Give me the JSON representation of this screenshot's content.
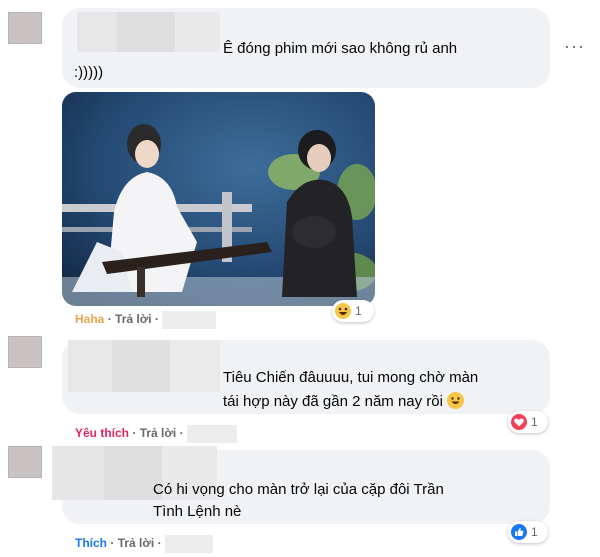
{
  "comments": [
    {
      "text_lines": [
        "Ê đóng phim mới sao không rủ anh",
        ":)))))"
      ],
      "reaction_label": "Haha",
      "reply_label": "Trả lời",
      "separator": "·",
      "reaction_count": "1",
      "more_icon": "more-horizontal-icon",
      "attachment": "photo-two-people-instrument"
    },
    {
      "text_lines": [
        "Tiêu Chiến đâuuuu, tui mong chờ màn",
        "tái hợp này đã gần 2 năm nay rồi"
      ],
      "emoji": "😀",
      "reaction_label": "Yêu thích",
      "reply_label": "Trả lời",
      "separator": "·",
      "reaction_count": "1"
    },
    {
      "text_lines": [
        "Có hi vọng cho màn trở lại của cặp đôi Trần",
        "Tình Lệnh nè"
      ],
      "reaction_label": "Thích",
      "reply_label": "Trả lời",
      "separator": "·",
      "reaction_count": "1"
    }
  ],
  "colors": {
    "bubble": "#f0f2f5",
    "haha": "#e8a64a",
    "love": "#e0245e",
    "like": "#1877f2",
    "muted": "#65676b"
  }
}
